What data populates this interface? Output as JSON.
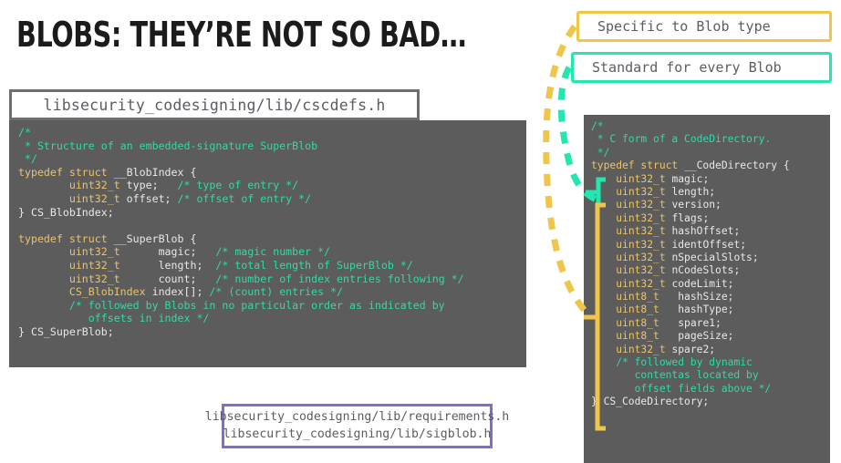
{
  "slide": {
    "title": "Blobs: They’re not so bad…"
  },
  "colors": {
    "code_background": "#5c5c5c",
    "comment": "#32d9a8",
    "keyword": "#e9c468",
    "identifier": "#e8e8e8",
    "legend_specific_border": "#f0c64a",
    "legend_standard_border": "#22e8b0",
    "file_header_border": "#6e6e6e",
    "file_footer_border": "#7b6fd4",
    "title_text": "#1b1b1b",
    "file_text": "#5c5c63"
  },
  "file_header": {
    "path": "libsecurity_codesigning/lib/cscdefs.h"
  },
  "file_footer": {
    "line1": "libsecurity_codesigning/lib/requirements.h",
    "line2": "libsecurity_codesigning/lib/sigblob.h"
  },
  "legend": {
    "specific": "Specific to Blob type",
    "standard": "Standard for every Blob"
  },
  "code_left": {
    "lines": [
      [
        {
          "t": "/*",
          "c": "cmt"
        }
      ],
      [
        {
          "t": " * Structure of an embedded-signature SuperBlob",
          "c": "cmt"
        }
      ],
      [
        {
          "t": " */",
          "c": "cmt"
        }
      ],
      [
        {
          "t": "typedef struct",
          "c": "kw"
        },
        {
          "t": " __BlobIndex {",
          "c": "id"
        }
      ],
      [
        {
          "t": "        ",
          "c": "id"
        },
        {
          "t": "uint32_t",
          "c": "typ"
        },
        {
          "t": " type;   ",
          "c": "id"
        },
        {
          "t": "/* type of entry */",
          "c": "cmt"
        }
      ],
      [
        {
          "t": "        ",
          "c": "id"
        },
        {
          "t": "uint32_t",
          "c": "typ"
        },
        {
          "t": " offset; ",
          "c": "id"
        },
        {
          "t": "/* offset of entry */",
          "c": "cmt"
        }
      ],
      [
        {
          "t": "} CS_BlobIndex;",
          "c": "id"
        }
      ],
      [
        {
          "t": "",
          "c": "id"
        }
      ],
      [
        {
          "t": "typedef struct",
          "c": "kw"
        },
        {
          "t": " __SuperBlob {",
          "c": "id"
        }
      ],
      [
        {
          "t": "        ",
          "c": "id"
        },
        {
          "t": "uint32_t",
          "c": "typ"
        },
        {
          "t": "      magic;   ",
          "c": "id"
        },
        {
          "t": "/* magic number */",
          "c": "cmt"
        }
      ],
      [
        {
          "t": "        ",
          "c": "id"
        },
        {
          "t": "uint32_t",
          "c": "typ"
        },
        {
          "t": "      length;  ",
          "c": "id"
        },
        {
          "t": "/* total length of SuperBlob */",
          "c": "cmt"
        }
      ],
      [
        {
          "t": "        ",
          "c": "id"
        },
        {
          "t": "uint32_t",
          "c": "typ"
        },
        {
          "t": "      count;   ",
          "c": "id"
        },
        {
          "t": "/* number of index entries following */",
          "c": "cmt"
        }
      ],
      [
        {
          "t": "        ",
          "c": "id"
        },
        {
          "t": "CS_BlobIndex",
          "c": "typ"
        },
        {
          "t": " index[]; ",
          "c": "id"
        },
        {
          "t": "/* (count) entries */",
          "c": "cmt"
        }
      ],
      [
        {
          "t": "        ",
          "c": "id"
        },
        {
          "t": "/* followed by Blobs in no particular order as indicated by",
          "c": "cmt"
        }
      ],
      [
        {
          "t": "           offsets in index */",
          "c": "cmt"
        }
      ],
      [
        {
          "t": "} CS_SuperBlob;",
          "c": "id"
        }
      ]
    ]
  },
  "code_right": {
    "lines": [
      [
        {
          "t": "/*",
          "c": "cmt"
        }
      ],
      [
        {
          "t": " * C form of a CodeDirectory.",
          "c": "cmt"
        }
      ],
      [
        {
          "t": " */",
          "c": "cmt"
        }
      ],
      [
        {
          "t": "typedef struct",
          "c": "kw"
        },
        {
          "t": " __CodeDirectory {",
          "c": "id"
        }
      ],
      [
        {
          "t": "    ",
          "c": "id"
        },
        {
          "t": "uint32_t",
          "c": "typ"
        },
        {
          "t": " magic;",
          "c": "id"
        }
      ],
      [
        {
          "t": "    ",
          "c": "id"
        },
        {
          "t": "uint32_t",
          "c": "typ"
        },
        {
          "t": " length;",
          "c": "id"
        }
      ],
      [
        {
          "t": "    ",
          "c": "id"
        },
        {
          "t": "uint32_t",
          "c": "typ"
        },
        {
          "t": " version;",
          "c": "id"
        }
      ],
      [
        {
          "t": "    ",
          "c": "id"
        },
        {
          "t": "uint32_t",
          "c": "typ"
        },
        {
          "t": " flags;",
          "c": "id"
        }
      ],
      [
        {
          "t": "    ",
          "c": "id"
        },
        {
          "t": "uint32_t",
          "c": "typ"
        },
        {
          "t": " hashOffset;",
          "c": "id"
        }
      ],
      [
        {
          "t": "    ",
          "c": "id"
        },
        {
          "t": "uint32_t",
          "c": "typ"
        },
        {
          "t": " identOffset;",
          "c": "id"
        }
      ],
      [
        {
          "t": "    ",
          "c": "id"
        },
        {
          "t": "uint32_t",
          "c": "typ"
        },
        {
          "t": " nSpecialSlots;",
          "c": "id"
        }
      ],
      [
        {
          "t": "    ",
          "c": "id"
        },
        {
          "t": "uint32_t",
          "c": "typ"
        },
        {
          "t": " nCodeSlots;",
          "c": "id"
        }
      ],
      [
        {
          "t": "    ",
          "c": "id"
        },
        {
          "t": "uint32_t",
          "c": "typ"
        },
        {
          "t": " codeLimit;",
          "c": "id"
        }
      ],
      [
        {
          "t": "    ",
          "c": "id"
        },
        {
          "t": "uint8_t ",
          "c": "typ"
        },
        {
          "t": "  hashSize;",
          "c": "id"
        }
      ],
      [
        {
          "t": "    ",
          "c": "id"
        },
        {
          "t": "uint8_t ",
          "c": "typ"
        },
        {
          "t": "  hashType;",
          "c": "id"
        }
      ],
      [
        {
          "t": "    ",
          "c": "id"
        },
        {
          "t": "uint8_t ",
          "c": "typ"
        },
        {
          "t": "  spare1;",
          "c": "id"
        }
      ],
      [
        {
          "t": "    ",
          "c": "id"
        },
        {
          "t": "uint8_t ",
          "c": "typ"
        },
        {
          "t": "  pageSize;",
          "c": "id"
        }
      ],
      [
        {
          "t": "    ",
          "c": "id"
        },
        {
          "t": "uint32_t",
          "c": "typ"
        },
        {
          "t": " spare2;",
          "c": "id"
        }
      ],
      [
        {
          "t": "    ",
          "c": "id"
        },
        {
          "t": "/* followed by dynamic",
          "c": "cmt"
        }
      ],
      [
        {
          "t": "       contentas located by",
          "c": "cmt"
        }
      ],
      [
        {
          "t": "       offset fields above */",
          "c": "cmt"
        }
      ],
      [
        {
          "t": "} CS_CodeDirectory;",
          "c": "id"
        }
      ]
    ]
  },
  "annotations": {
    "bracket_standard_label": "standard-fields-bracket",
    "bracket_specific_label": "specific-fields-bracket",
    "connector_standard_label": "standard-connector",
    "connector_specific_label": "specific-connector"
  }
}
